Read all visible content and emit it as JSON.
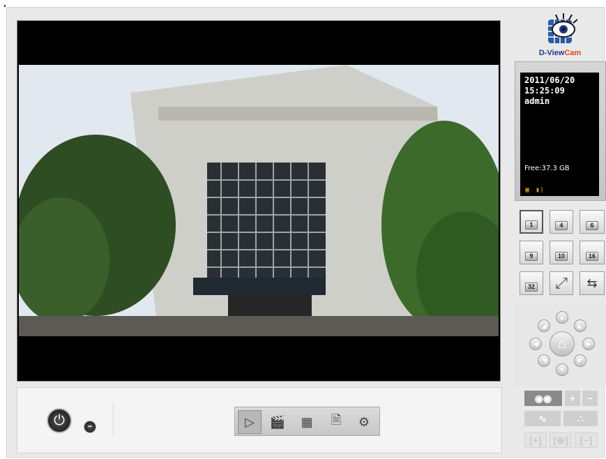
{
  "brand": {
    "name_prefix": "D-View",
    "name_suffix": "Cam"
  },
  "info": {
    "date": "2011/06/20",
    "time": "15:25:09",
    "user": "admin",
    "free_space": "Free:37.3 GB"
  },
  "layouts": [
    "1",
    "4",
    "6",
    "9",
    "10",
    "16",
    "32"
  ],
  "selected_layout": "1",
  "toolbar": {
    "icons": [
      "playback-icon",
      "clapperboard-icon",
      "schedule-icon",
      "document-icon",
      "gear-icon"
    ]
  },
  "colors": {
    "accent": "#e04a1a",
    "brand_blue": "#1e3a8a",
    "panel": "#e9e9e9"
  }
}
